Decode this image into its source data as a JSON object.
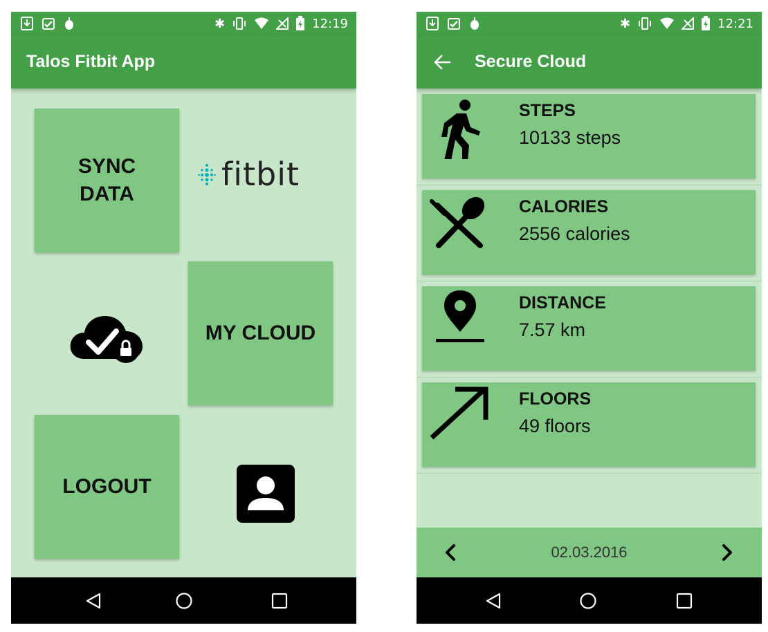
{
  "phone1": {
    "status": {
      "time": "12:19"
    },
    "appbar": {
      "title": "Talos Fitbit App"
    },
    "tiles": {
      "sync_line1": "SYNC",
      "sync_line2": "DATA",
      "my_cloud": "MY CLOUD",
      "logout": "LOGOUT"
    },
    "fitbit_logo_text": "fitbit",
    "icons": [
      "cloud-check-lock-icon",
      "contact-card-icon",
      "fitbit-logo"
    ]
  },
  "phone2": {
    "status": {
      "time": "12:21"
    },
    "appbar": {
      "title": "Secure Cloud"
    },
    "cards": [
      {
        "title": "STEPS",
        "value": "10133 steps",
        "icon": "walking-person-icon"
      },
      {
        "title": "CALORIES",
        "value": "2556 calories",
        "icon": "fork-spoon-icon"
      },
      {
        "title": "DISTANCE",
        "value": "7.57 km",
        "icon": "location-pin-icon"
      },
      {
        "title": "FLOORS",
        "value": "49 floors",
        "icon": "arrow-up-right-icon"
      }
    ],
    "date": "02.03.2016"
  },
  "colors": {
    "primary": "#43a047",
    "tile": "#81c784",
    "background": "#c8e6c9",
    "navbar": "#000000"
  }
}
